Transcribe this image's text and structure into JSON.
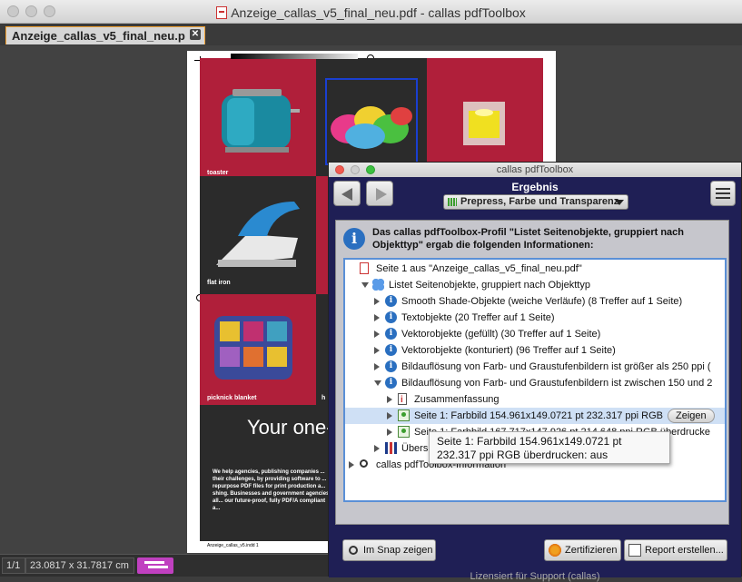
{
  "window": {
    "title": "Anzeige_callas_v5_final_neu.pdf - callas pdfToolbox"
  },
  "tab": {
    "label": "Anzeige_callas_v5_final_neu.p",
    "close": "✕"
  },
  "document": {
    "labels": [
      "toaster",
      "flat iron",
      "picknick blanket",
      "h"
    ],
    "heading": "Your one-",
    "body_text": "We help agencies, publishing companies ... their challenges, by providing software to ... repurpose PDF files for print production a... shing. Businesses and government agencies all... our future-proof, fully PDF/A compliant a...",
    "footer_text": "Anzeige_callas_v5.indd 1",
    "colors": {
      "red": "#b01f3a",
      "dark": "#2b2b2b"
    }
  },
  "statusbar": {
    "page": "1/1",
    "size": "23.0817 x 31.7817 cm"
  },
  "palette": {
    "title": "callas pdfToolbox",
    "heading": "Ergebnis",
    "profile": "Prepress, Farbe und Transparenz",
    "info_text": "Das callas pdfToolbox-Profil \"Listet Seitenobjekte, gruppiert nach Objekttyp\" ergab die folgenden Informationen:",
    "tree": [
      {
        "label": "Seite 1 aus \"Anzeige_callas_v5_final_neu.pdf\"",
        "icon": "pdf-icon",
        "indent": 0,
        "toggle": "none"
      },
      {
        "label": "Listet Seitenobjekte, gruppiert nach Objekttyp",
        "icon": "group-icon",
        "indent": 1,
        "toggle": "down"
      },
      {
        "label": "Smooth Shade-Objekte (weiche Verläufe) (8 Treffer auf 1 Seite)",
        "icon": "info-icon",
        "indent": 2,
        "toggle": "right"
      },
      {
        "label": "Textobjekte (20 Treffer auf 1 Seite)",
        "icon": "info-icon",
        "indent": 2,
        "toggle": "right"
      },
      {
        "label": "Vektorobjekte (gefüllt) (30 Treffer auf 1 Seite)",
        "icon": "info-icon",
        "indent": 2,
        "toggle": "right"
      },
      {
        "label": "Vektorobjekte (konturiert) (96 Treffer auf 1 Seite)",
        "icon": "info-icon",
        "indent": 2,
        "toggle": "right"
      },
      {
        "label": "Bildauflösung von Farb- und Graustufenbildern ist größer als 250 ppi (",
        "icon": "info-icon",
        "indent": 2,
        "toggle": "right"
      },
      {
        "label": "Bildauflösung von Farb- und Graustufenbildern ist zwischen 150 und 2",
        "icon": "info-icon",
        "indent": 2,
        "toggle": "down"
      },
      {
        "label": "Zusammenfassung",
        "icon": "summary-icon",
        "indent": 3,
        "toggle": "right"
      },
      {
        "label": "Seite 1: Farbbild 154.961x149.0721 pt 232.317 ppi RGB",
        "icon": "image-icon",
        "indent": 3,
        "toggle": "right",
        "selected": true
      },
      {
        "label": "Seite 1: Farbbild 167.717x147.926 pt 214.648 ppi RGB überdrucke",
        "icon": "image-icon",
        "indent": 3,
        "toggle": "right"
      },
      {
        "label": "Übersich",
        "icon": "chart-icon",
        "indent": 2,
        "toggle": "right"
      },
      {
        "label": "callas pdfToolbox-Information",
        "icon": "magnifier-icon",
        "indent": 0,
        "toggle": "right"
      }
    ],
    "show_button": "Zeigen",
    "tooltip": "Seite 1: Farbbild 154.961x149.0721 pt 232.317 ppi RGB überdrucken: aus",
    "buttons": {
      "snap": "Im Snap zeigen",
      "certify": "Zertifizieren",
      "report": "Report erstellen..."
    },
    "license": "Lizensiert für Support (callas)"
  }
}
